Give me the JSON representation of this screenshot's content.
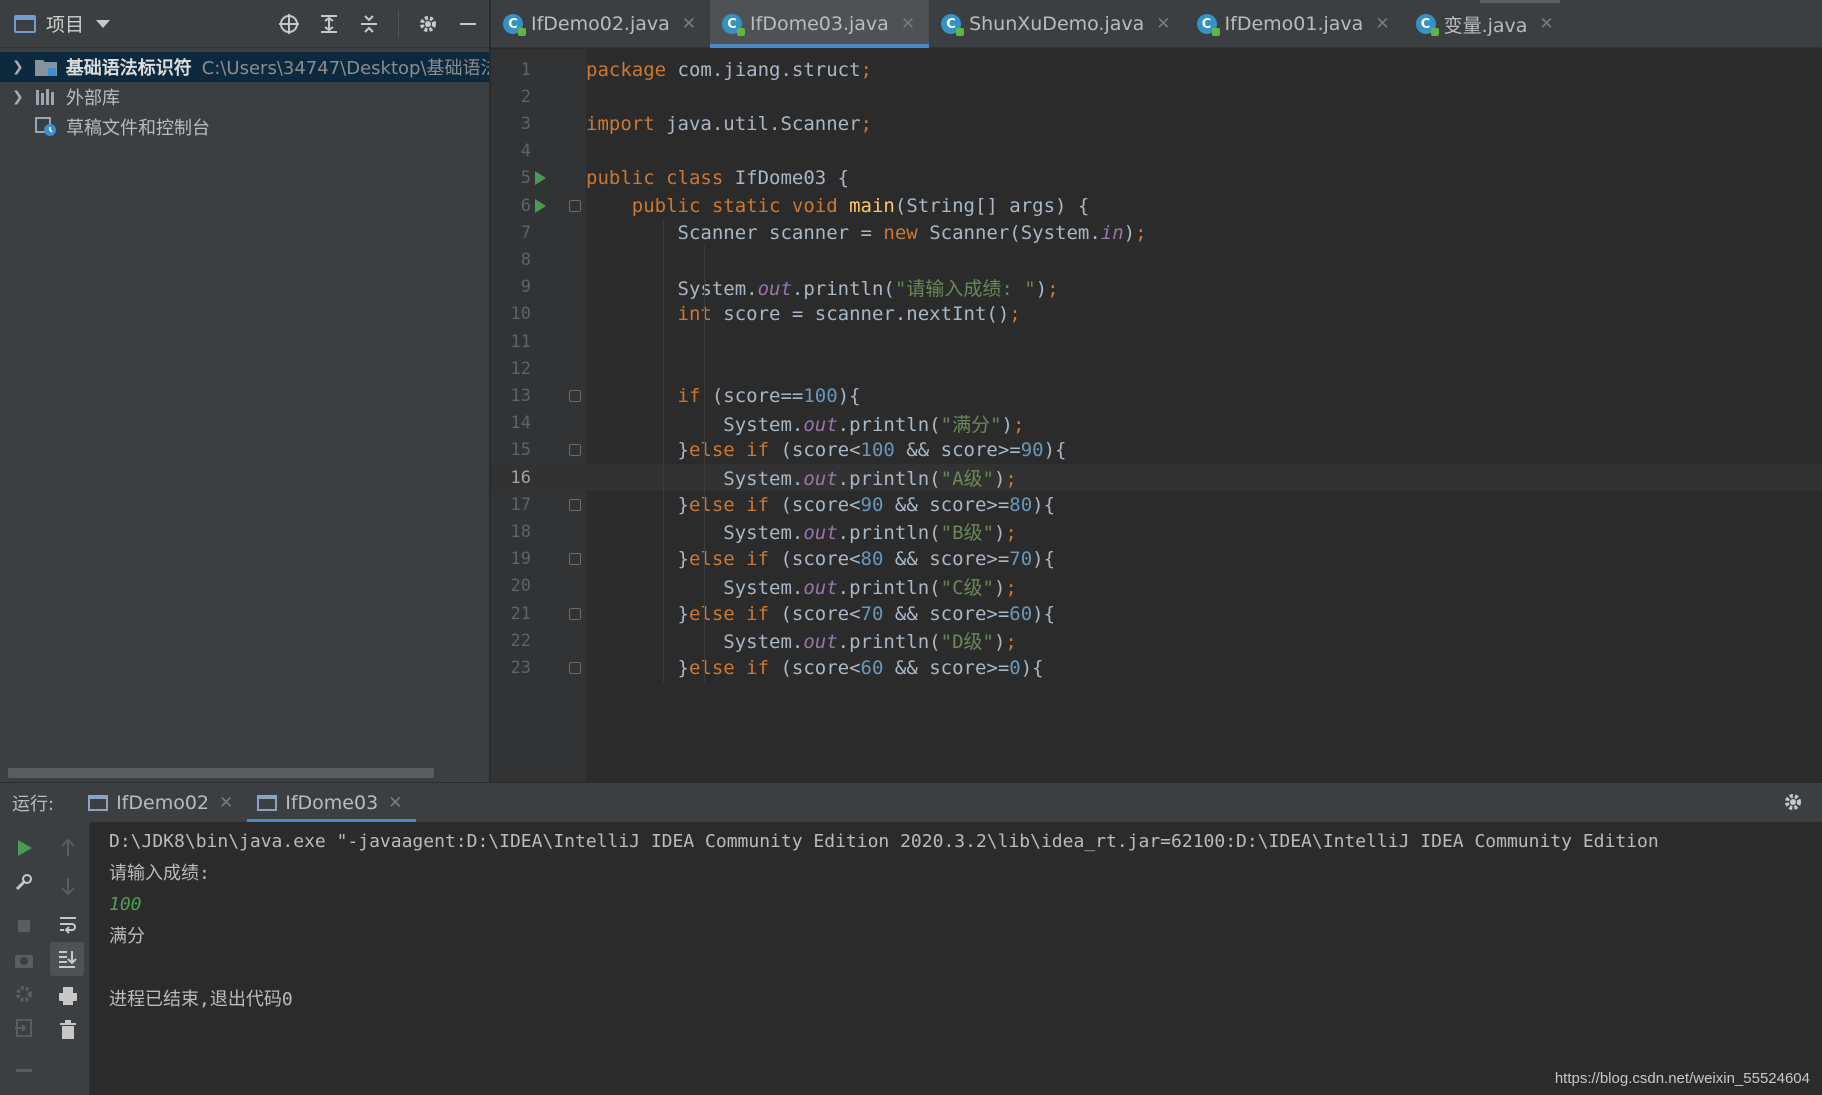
{
  "project_panel": {
    "title": "项目",
    "tree": [
      {
        "label": "基础语法标识符",
        "path": "C:\\Users\\34747\\Desktop\\基础语法",
        "selected": true,
        "expandable": true
      },
      {
        "label": "外部库",
        "expandable": true
      },
      {
        "label": "草稿文件和控制台",
        "expandable": false
      }
    ]
  },
  "editor": {
    "tabs": [
      {
        "label": "IfDemo02.java",
        "active": false
      },
      {
        "label": "IfDome03.java",
        "active": true
      },
      {
        "label": "ShunXuDemo.java",
        "active": false
      },
      {
        "label": "IfDemo01.java",
        "active": false
      },
      {
        "label": "变量.java",
        "active": false
      }
    ],
    "current_line": 16,
    "lines": [
      {
        "n": "1",
        "tokens": [
          [
            "kw",
            "package "
          ],
          [
            "",
            "com.jiang.struct"
          ],
          [
            "kw",
            ";"
          ]
        ]
      },
      {
        "n": "2",
        "tokens": []
      },
      {
        "n": "3",
        "tokens": [
          [
            "kw",
            "import "
          ],
          [
            "",
            "java.util.Scanner"
          ],
          [
            "kw",
            ";"
          ]
        ]
      },
      {
        "n": "4",
        "tokens": []
      },
      {
        "n": "5",
        "tokens": [
          [
            "kw",
            "public class "
          ],
          [
            "",
            "IfDome03 {"
          ]
        ],
        "run": true
      },
      {
        "n": "6",
        "tokens": [
          [
            "",
            "    "
          ],
          [
            "kw",
            "public static void "
          ],
          [
            "mth",
            "main"
          ],
          [
            "",
            "(String[] args) {"
          ]
        ],
        "run": true,
        "fold": true
      },
      {
        "n": "7",
        "tokens": [
          [
            "",
            "        Scanner scanner = "
          ],
          [
            "kw",
            "new "
          ],
          [
            "",
            "Scanner(System."
          ],
          [
            "fld",
            "in"
          ],
          [
            "",
            ")"
          ],
          [
            "kw",
            ";"
          ]
        ]
      },
      {
        "n": "8",
        "tokens": []
      },
      {
        "n": "9",
        "tokens": [
          [
            "",
            "        System."
          ],
          [
            "fld",
            "out"
          ],
          [
            "",
            ".println("
          ],
          [
            "str",
            "\"请输入成绩: \""
          ],
          [
            "",
            ")"
          ],
          [
            "kw",
            ";"
          ]
        ]
      },
      {
        "n": "10",
        "tokens": [
          [
            "",
            "        "
          ],
          [
            "kw",
            "int "
          ],
          [
            "",
            "score = scanner.nextInt()"
          ],
          [
            "kw",
            ";"
          ]
        ]
      },
      {
        "n": "11",
        "tokens": []
      },
      {
        "n": "12",
        "tokens": []
      },
      {
        "n": "13",
        "tokens": [
          [
            "",
            "        "
          ],
          [
            "kw",
            "if "
          ],
          [
            "",
            "(score=="
          ],
          [
            "num",
            "100"
          ],
          [
            "",
            "){"
          ]
        ],
        "fold": true
      },
      {
        "n": "14",
        "tokens": [
          [
            "",
            "            System."
          ],
          [
            "fld",
            "out"
          ],
          [
            "",
            ".println("
          ],
          [
            "str",
            "\"满分\""
          ],
          [
            "",
            ")"
          ],
          [
            "kw",
            ";"
          ]
        ]
      },
      {
        "n": "15",
        "tokens": [
          [
            "",
            "        }"
          ],
          [
            "kw",
            "else if "
          ],
          [
            "",
            "(score<"
          ],
          [
            "num",
            "100"
          ],
          [
            "",
            " && score>="
          ],
          [
            "num",
            "90"
          ],
          [
            "",
            "){"
          ]
        ],
        "fold": true
      },
      {
        "n": "16",
        "tokens": [
          [
            "",
            "            System."
          ],
          [
            "fld",
            "out"
          ],
          [
            "",
            ".println("
          ],
          [
            "str",
            "\"A级\""
          ],
          [
            "",
            ")"
          ],
          [
            "kw",
            ";"
          ]
        ]
      },
      {
        "n": "17",
        "tokens": [
          [
            "",
            "        }"
          ],
          [
            "kw",
            "else if "
          ],
          [
            "",
            "(score<"
          ],
          [
            "num",
            "90"
          ],
          [
            "",
            " && score>="
          ],
          [
            "num",
            "80"
          ],
          [
            "",
            "){"
          ]
        ],
        "fold": true
      },
      {
        "n": "18",
        "tokens": [
          [
            "",
            "            System."
          ],
          [
            "fld",
            "out"
          ],
          [
            "",
            ".println("
          ],
          [
            "str",
            "\"B级\""
          ],
          [
            "",
            ")"
          ],
          [
            "kw",
            ";"
          ]
        ]
      },
      {
        "n": "19",
        "tokens": [
          [
            "",
            "        }"
          ],
          [
            "kw",
            "else if "
          ],
          [
            "",
            "(score<"
          ],
          [
            "num",
            "80"
          ],
          [
            "",
            " && score>="
          ],
          [
            "num",
            "70"
          ],
          [
            "",
            "){"
          ]
        ],
        "fold": true
      },
      {
        "n": "20",
        "tokens": [
          [
            "",
            "            System."
          ],
          [
            "fld",
            "out"
          ],
          [
            "",
            ".println("
          ],
          [
            "str",
            "\"C级\""
          ],
          [
            "",
            ")"
          ],
          [
            "kw",
            ";"
          ]
        ]
      },
      {
        "n": "21",
        "tokens": [
          [
            "",
            "        }"
          ],
          [
            "kw",
            "else if "
          ],
          [
            "",
            "(score<"
          ],
          [
            "num",
            "70"
          ],
          [
            "",
            " && score>="
          ],
          [
            "num",
            "60"
          ],
          [
            "",
            "){"
          ]
        ],
        "fold": true
      },
      {
        "n": "22",
        "tokens": [
          [
            "",
            "            System."
          ],
          [
            "fld",
            "out"
          ],
          [
            "",
            ".println("
          ],
          [
            "str",
            "\"D级\""
          ],
          [
            "",
            ")"
          ],
          [
            "kw",
            ";"
          ]
        ]
      },
      {
        "n": "23",
        "tokens": [
          [
            "",
            "        }"
          ],
          [
            "kw",
            "else if "
          ],
          [
            "",
            "(score<"
          ],
          [
            "num",
            "60"
          ],
          [
            "",
            " && score>="
          ],
          [
            "num",
            "0"
          ],
          [
            "",
            "){"
          ]
        ],
        "fold": true
      }
    ]
  },
  "run_panel": {
    "label": "运行:",
    "tabs": [
      {
        "label": "IfDemo02",
        "active": false
      },
      {
        "label": "IfDome03",
        "active": true
      }
    ],
    "console": [
      {
        "text": "D:\\JDK8\\bin\\java.exe \"-javaagent:D:\\IDEA\\IntelliJ IDEA Community Edition 2020.3.2\\lib\\idea_rt.jar=62100:D:\\IDEA\\IntelliJ IDEA Community Edition",
        "kind": "normal"
      },
      {
        "text": "请输入成绩:",
        "kind": "normal"
      },
      {
        "text": "100",
        "kind": "input"
      },
      {
        "text": "满分",
        "kind": "normal"
      },
      {
        "text": "",
        "kind": "normal"
      },
      {
        "text": "进程已结束,退出代码0",
        "kind": "normal"
      }
    ]
  },
  "watermark": "https://blog.csdn.net/weixin_55524604",
  "colors": {
    "keyword": "#cc7832",
    "string": "#6a8759",
    "number": "#6897bb",
    "field": "#9876aa",
    "method": "#ffc66d",
    "console_input": "#4fa04f",
    "accent": "#4a88c7"
  }
}
